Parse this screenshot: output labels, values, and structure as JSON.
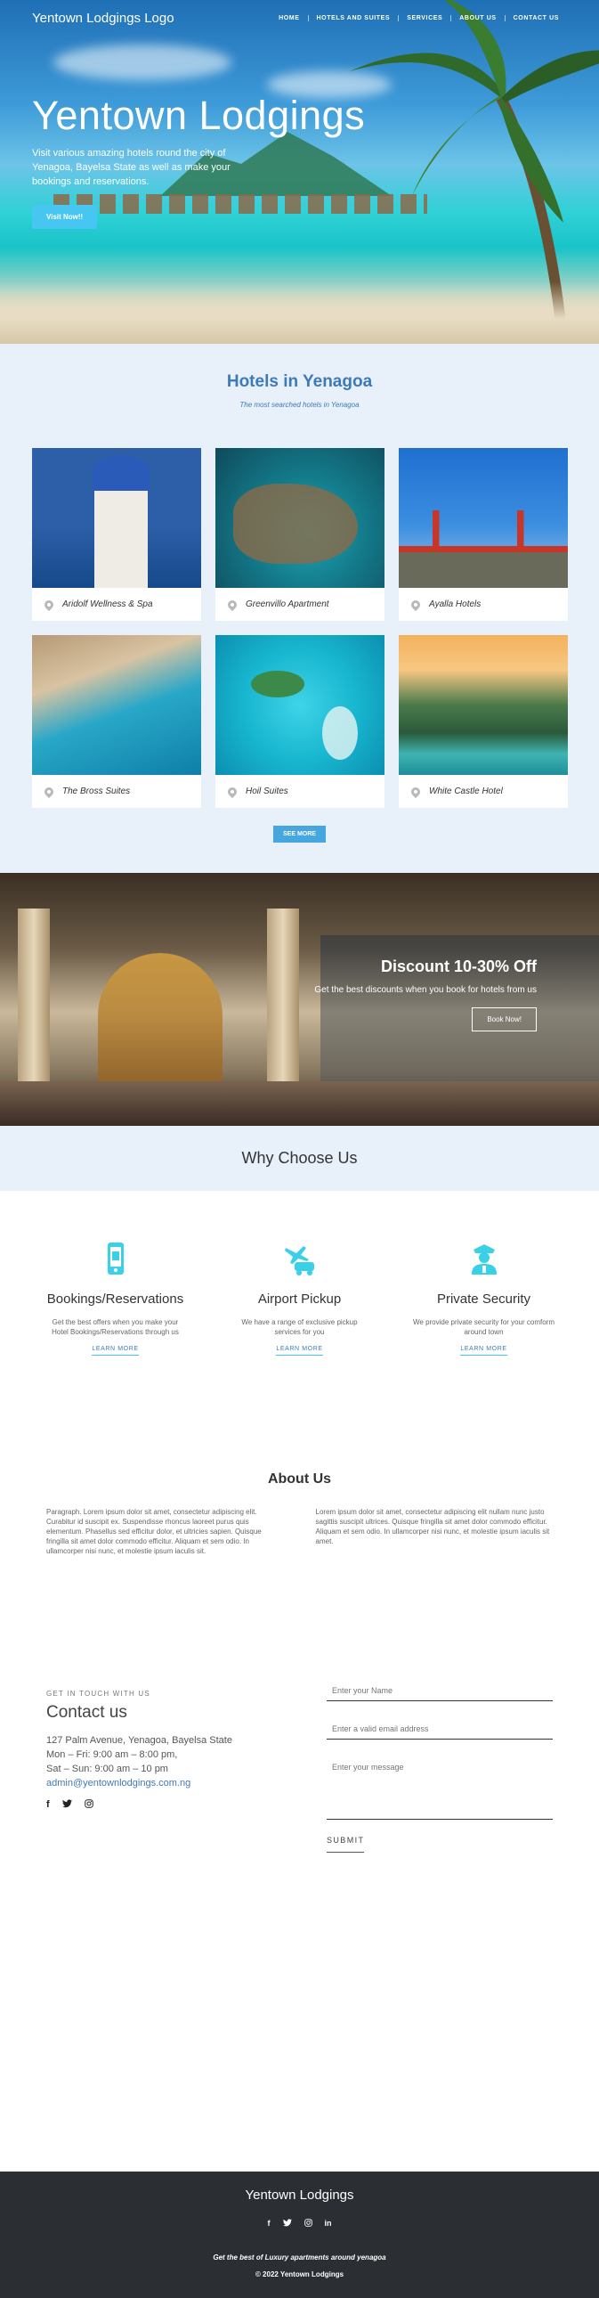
{
  "nav": {
    "logo": "Yentown Lodgings Logo",
    "links": [
      "HOME",
      "HOTELS AND SUITES",
      "SERVICES",
      "ABOUT US",
      "CONTACT US"
    ]
  },
  "hero": {
    "title": "Yentown Lodgings",
    "subtitle": "Visit various amazing hotels round the city of Yenagoa, Bayelsa State as well as make your bookings and reservations.",
    "button": "Visit Now!!"
  },
  "hotels": {
    "title": "Hotels in Yenagoa",
    "subtitle": "The most searched hotels in Yenagoa",
    "items": [
      {
        "name": "Aridolf Wellness & Spa"
      },
      {
        "name": "Greenvillo Apartment"
      },
      {
        "name": "Ayalla Hotels"
      },
      {
        "name": "The Bross Suites"
      },
      {
        "name": "Hoil Suites"
      },
      {
        "name": "White Castle Hotel"
      }
    ],
    "more_button": "SEE MORE"
  },
  "discount": {
    "title": "Discount 10-30% Off",
    "subtitle": "Get the best discounts when you book for hotels from us",
    "button": "Book Now!"
  },
  "why": {
    "title": "Why Choose Us",
    "features": [
      {
        "title": "Bookings/Reservations",
        "text": "Get the best offers when you make your Hotel Bookings/Reservations through us",
        "link": "LEARN MORE",
        "icon": "phone-booking-icon"
      },
      {
        "title": "Airport Pickup",
        "text": "We have a range of exclusive pickup services for you",
        "link": "LEARN MORE",
        "icon": "airport-pickup-icon"
      },
      {
        "title": "Private Security",
        "text": "We provide private security for your comform around town",
        "link": "LEARN MORE",
        "icon": "security-guard-icon"
      }
    ]
  },
  "about": {
    "title": "About Us",
    "col1": "Paragraph. Lorem ipsum dolor sit amet, consectetur adipiscing elit. Curabitur id suscipit ex. Suspendisse rhoncus laoreet purus quis elementum. Phasellus sed efficitur dolor, et ultricies sapien. Quisque fringilla sit amet dolor commodo efficitur. Aliquam et sem odio. In ullamcorper nisi nunc, et molestie ipsum iaculis sit.",
    "col2": "Lorem ipsum dolor sit amet, consectetur adipiscing elit nullam nunc justo sagittis suscipit ultrices. Quisque fringilla sit amet dolor commodo efficitur. Aliquam et sem odio. In ullamcorper nisi nunc, et molestie ipsum iaculis sit amet."
  },
  "contact": {
    "eyebrow": "GET IN TOUCH WITH US",
    "title": "Contact us",
    "address": "127 Palm Avenue, Yenagoa, Bayelsa State",
    "hours1": "Mon – Fri: 9:00 am – 8:00 pm,",
    "hours2": "Sat – Sun: 9:00 am – 10 pm",
    "email": "admin@yentownlodgings.com.ng",
    "social": [
      "f",
      "t",
      "ig"
    ],
    "name_placeholder": "Enter your Name",
    "email_placeholder": "Enter a valid email address",
    "message_placeholder": "Enter your message",
    "submit": "SUBMIT"
  },
  "footer": {
    "title": "Yentown Lodgings",
    "social": [
      "f",
      "t",
      "ig",
      "in"
    ],
    "tagline": "Get the best of Luxury apartments around yenagoa",
    "copyright": "© 2022 Yentown Lodgings"
  },
  "colors": {
    "accent": "#46c6f0",
    "heading_blue": "#3e7ab8",
    "light_bg": "#e8f0fa",
    "footer_bg": "#2b2e33"
  }
}
